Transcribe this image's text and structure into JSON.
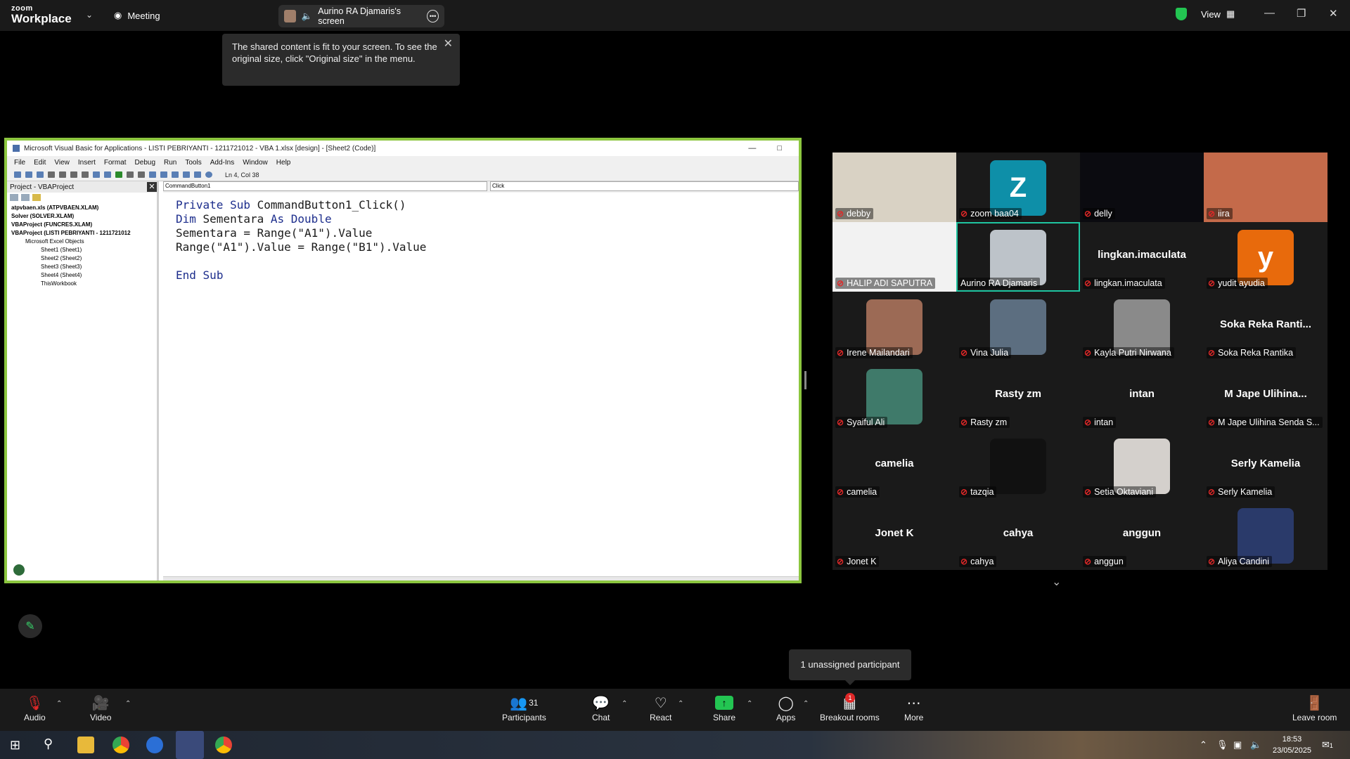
{
  "topbar": {
    "logo_top": "zoom",
    "logo_bottom": "Workplace",
    "meeting_label": "Meeting",
    "screen_share_label": "Aurino RA Djamaris's screen",
    "view_label": "View",
    "window_controls": [
      "minimize-icon",
      "maximize-icon",
      "close-icon"
    ]
  },
  "tooltip": {
    "text": "The shared content is fit to your screen. To see the original size, click \"Original size\" in the menu."
  },
  "vbe": {
    "title": "Microsoft Visual Basic for Applications - LISTI PEBRIYANTI - 1211721012 - VBA 1.xlsx [design] - [Sheet2 (Code)]",
    "menu": [
      "File",
      "Edit",
      "View",
      "Insert",
      "Format",
      "Debug",
      "Run",
      "Tools",
      "Add-Ins",
      "Window",
      "Help"
    ],
    "status": "Ln 4, Col 38",
    "project_title": "Project - VBAProject",
    "tree": [
      {
        "level": 1,
        "text": "atpvbaen.xls (ATPVBAEN.XLAM)"
      },
      {
        "level": 1,
        "text": "Solver (SOLVER.XLAM)"
      },
      {
        "level": 1,
        "text": "VBAProject (FUNCRES.XLAM)"
      },
      {
        "level": 1,
        "text": "VBAProject (LISTI PEBRIYANTI - 1211721012"
      },
      {
        "level": 2,
        "text": "Microsoft Excel Objects"
      },
      {
        "level": 3,
        "text": "Sheet1 (Sheet1)"
      },
      {
        "level": 3,
        "text": "Sheet2 (Sheet2)"
      },
      {
        "level": 3,
        "text": "Sheet3 (Sheet3)"
      },
      {
        "level": 3,
        "text": "Sheet4 (Sheet4)"
      },
      {
        "level": 3,
        "text": "ThisWorkbook"
      }
    ],
    "object_combo": "CommandButton1",
    "proc_combo": "Click",
    "code_lines": [
      "Private Sub CommandButton1_Click()",
      "Dim Sementara As Double",
      "Sementara = Range(\"A1\").Value",
      "Range(\"A1\").Value = Range(\"B1\").Value",
      "",
      "End Sub"
    ]
  },
  "participants": [
    {
      "name": "debby",
      "display": "photo",
      "color": "#d9d2c4"
    },
    {
      "name": "zoom baa04",
      "display": "letter",
      "letter": "Z",
      "color": "#0e8fa8"
    },
    {
      "name": "delly",
      "display": "photo",
      "color": "#0b0b10"
    },
    {
      "name": "iira",
      "display": "photo",
      "color": "#c46a4a"
    },
    {
      "name": "HALIP ADI SAPUTRA",
      "display": "photo",
      "color": "#f2f2f2"
    },
    {
      "name": "Aurino RA Djamaris",
      "display": "avatar",
      "color": "#bdc3c9",
      "active": true,
      "muted": false
    },
    {
      "name": "lingkan.imaculata",
      "display": "name",
      "center": "lingkan.imaculata"
    },
    {
      "name": "yudit ayudia",
      "display": "letter",
      "letter": "y",
      "color": "#e86a0c"
    },
    {
      "name": "Irene Mailandari",
      "display": "avatar",
      "color": "#9c6a55"
    },
    {
      "name": "Vina Julia",
      "display": "avatar",
      "color": "#5c6e80"
    },
    {
      "name": "Kayla Putri Nirwana",
      "display": "avatar",
      "color": "#8a8a8a"
    },
    {
      "name": "Soka Reka Rantika",
      "display": "name",
      "center": "Soka Reka Ranti..."
    },
    {
      "name": "Syaiful Ali",
      "display": "avatar",
      "color": "#3f7a6a"
    },
    {
      "name": "Rasty zm",
      "display": "name",
      "center": "Rasty zm"
    },
    {
      "name": "intan",
      "display": "name",
      "center": "intan"
    },
    {
      "name": "M Jape Ulihina Senda S...",
      "display": "name",
      "center": "M Jape Ulihina..."
    },
    {
      "name": "camelia",
      "display": "name",
      "center": "camelia"
    },
    {
      "name": "tazqia",
      "display": "avatar",
      "color": "#111111"
    },
    {
      "name": "Setia Oktaviani",
      "display": "avatar",
      "color": "#d4d0cc"
    },
    {
      "name": "Serly Kamelia",
      "display": "name",
      "center": "Serly Kamelia"
    },
    {
      "name": "Jonet K",
      "display": "name",
      "center": "Jonet K"
    },
    {
      "name": "cahya",
      "display": "name",
      "center": "cahya"
    },
    {
      "name": "anggun",
      "display": "name",
      "center": "anggun"
    },
    {
      "name": "Aliya Candini",
      "display": "avatar",
      "color": "#2a3a6a"
    }
  ],
  "unassigned_tooltip": "1 unassigned participant",
  "toolbar": {
    "audio": "Audio",
    "video": "Video",
    "participants": "Participants",
    "participants_count": "31",
    "chat": "Chat",
    "react": "React",
    "share": "Share",
    "apps": "Apps",
    "breakout": "Breakout rooms",
    "breakout_badge": "1",
    "more": "More",
    "leave": "Leave room"
  },
  "taskbar": {
    "time": "18:53",
    "date": "23/05/2025",
    "notification_count": "1"
  }
}
